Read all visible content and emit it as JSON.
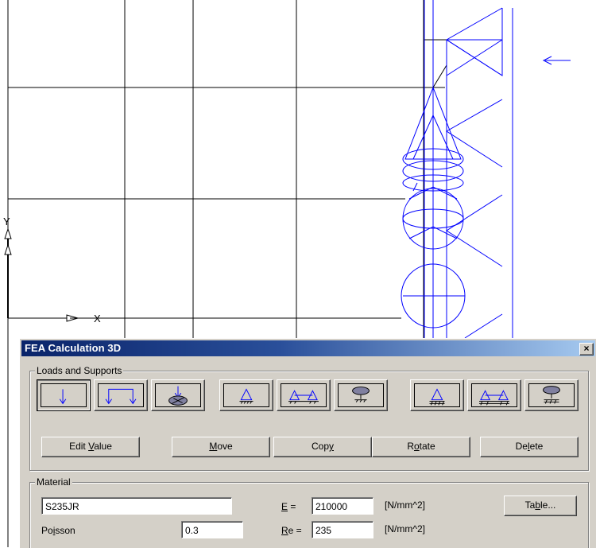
{
  "dialog": {
    "title": "FEA Calculation 3D",
    "close_glyph": "×"
  },
  "loads": {
    "group_label": "Loads and Supports",
    "tools": [
      {
        "name": "point-load-icon",
        "pressed": true
      },
      {
        "name": "distributed-load-icon",
        "pressed": false
      },
      {
        "name": "moment-load-icon",
        "pressed": false
      },
      {
        "name": "support-fixed-icon",
        "pressed": false
      },
      {
        "name": "support-line-icon",
        "pressed": false
      },
      {
        "name": "support-area-icon",
        "pressed": false
      },
      {
        "name": "support-fixed-hatched-icon",
        "pressed": false
      },
      {
        "name": "support-line-hatched-icon",
        "pressed": false
      },
      {
        "name": "support-area-hatched-icon",
        "pressed": false
      }
    ],
    "buttons": {
      "edit_value": {
        "pre": "Edit ",
        "ul": "V",
        "post": "alue"
      },
      "move": {
        "pre": "",
        "ul": "M",
        "post": "ove"
      },
      "copy": {
        "pre": "Cop",
        "ul": "y",
        "post": ""
      },
      "rotate": {
        "pre": "R",
        "ul": "o",
        "post": "tate"
      },
      "delete": {
        "pre": "De",
        "ul": "l",
        "post": "ete"
      }
    }
  },
  "material": {
    "group_label": "Material",
    "name_value": "S235JR",
    "poisson_label_pre": "Po",
    "poisson_label_ul": "i",
    "poisson_label_post": "sson",
    "poisson_value": "0.3",
    "e_label_ul": "E",
    "e_label_post": " =",
    "e_value": "210000",
    "e_unit": "[N/mm^2]",
    "re_label_ul": "R",
    "re_label_post": "e =",
    "re_value": "235",
    "re_unit": "[N/mm^2]",
    "table_button": {
      "pre": "Ta",
      "ul": "b",
      "post": "le..."
    }
  },
  "canvas": {
    "axis_y_label": "Y",
    "axis_x_label": "X",
    "line_color": "#000000",
    "model_color": "#0000ff"
  }
}
